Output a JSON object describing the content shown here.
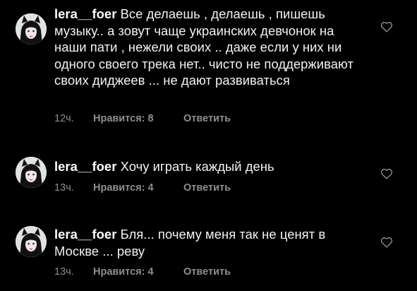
{
  "comments": [
    {
      "username": "lera__foer",
      "text": "Все делаешь , делаешь , пишешь музыку.. а зовут чаще украинских девчонок на наши пати , нежели своих .. даже если у них ни одного своего трека нет.. чисто не поддерживают своих диджеев ... не дают развиваться",
      "time": "12ч.",
      "likes": "Нравится: 8",
      "reply": "Ответить"
    },
    {
      "username": "lera__foer",
      "text": "Хочу играть каждый день",
      "time": "13ч.",
      "likes": "Нравится: 4",
      "reply": "Ответить"
    },
    {
      "username": "lera__foer",
      "text": "Бля... почему меня так не ценят в Москве ... реву",
      "time": "13ч.",
      "likes": "Нравится: 4",
      "reply": "Ответить"
    }
  ],
  "icons": {
    "avatar": "cat-ears-girl-avatar",
    "like": "heart-outline-icon"
  },
  "colors": {
    "background": "#000000",
    "text": "#f2f2f2",
    "meta": "#8e8e8e"
  }
}
